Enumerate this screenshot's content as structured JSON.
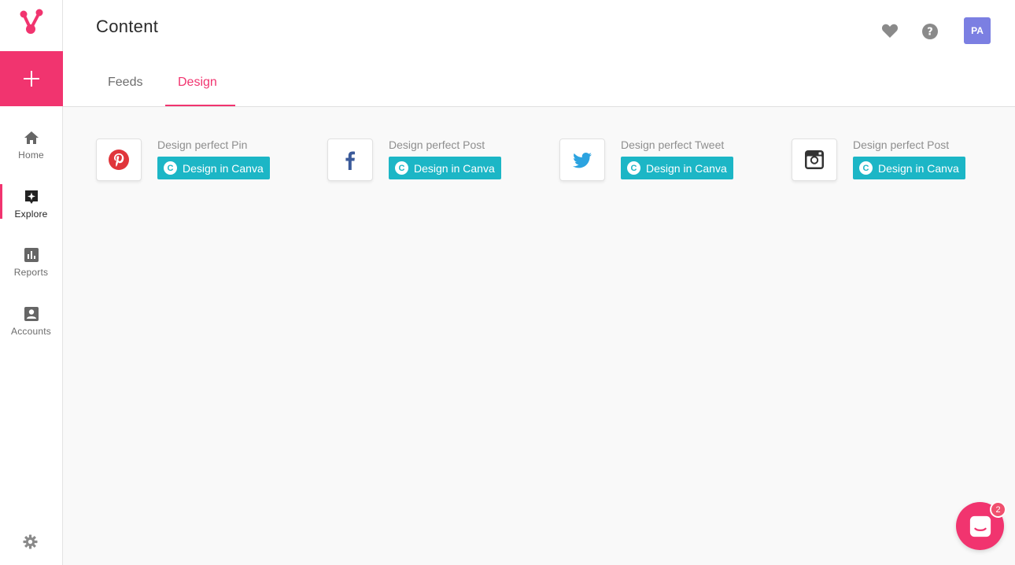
{
  "colors": {
    "accent": "#f1346f",
    "canva": "#1cb6c6",
    "avatar": "#7b7fe2"
  },
  "sidebar": {
    "logo_icon": "brand-logo-icon",
    "add_icon": "plus-icon",
    "items": [
      {
        "label": "Home",
        "icon": "home-icon"
      },
      {
        "label": "Explore",
        "icon": "explore-icon",
        "active": true
      },
      {
        "label": "Reports",
        "icon": "bar-chart-icon"
      },
      {
        "label": "Accounts",
        "icon": "account-icon"
      }
    ],
    "settings_icon": "gear-icon"
  },
  "header": {
    "title": "Content",
    "avatar_initials": "PA",
    "tabs": [
      {
        "label": "Feeds"
      },
      {
        "label": "Design",
        "active": true
      }
    ]
  },
  "cards": [
    {
      "network": "pinterest",
      "title": "Design perfect Pin",
      "button": "Design in Canva"
    },
    {
      "network": "facebook",
      "title": "Design perfect Post",
      "button": "Design in Canva"
    },
    {
      "network": "twitter",
      "title": "Design perfect Tweet",
      "button": "Design in Canva"
    },
    {
      "network": "instagram",
      "title": "Design perfect Post",
      "button": "Design in Canva"
    }
  ],
  "canva_mark": "C",
  "chat": {
    "badge": "2"
  }
}
